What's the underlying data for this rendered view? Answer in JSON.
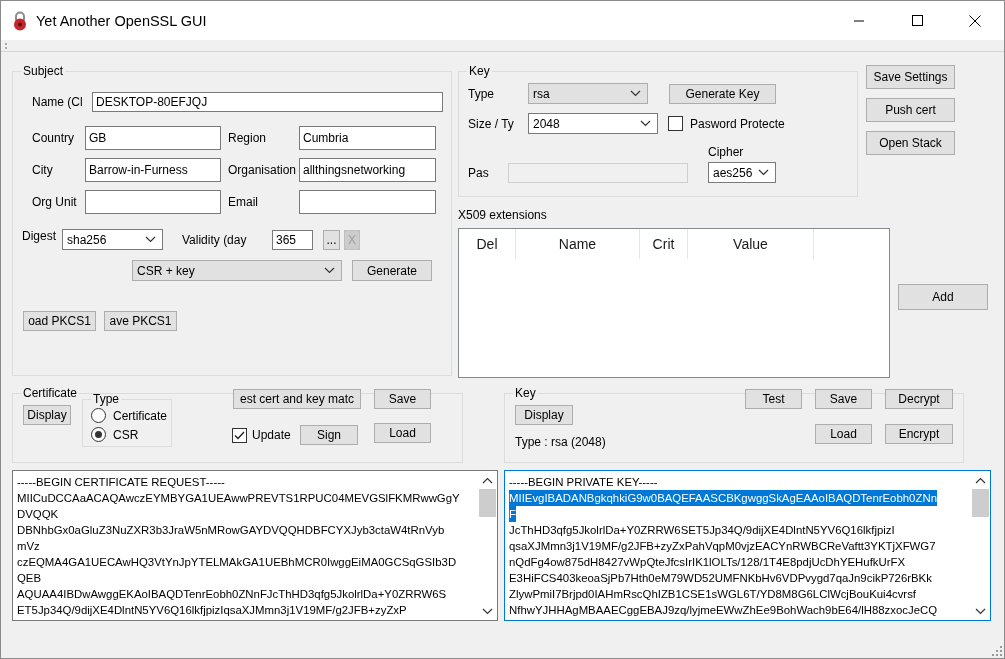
{
  "window": {
    "title": "Yet Another OpenSSL GUI"
  },
  "subject": {
    "title": "Subject",
    "name": {
      "label": "Name (Cl",
      "value": "DESKTOP-80EFJQJ"
    },
    "fields": [
      {
        "label": "Country",
        "value": "GB"
      },
      {
        "label": "Region",
        "value": "Cumbria"
      },
      {
        "label": "City",
        "value": "Barrow-in-Furness"
      },
      {
        "label": "Organisation",
        "value": "allthingsnetworking"
      },
      {
        "label": "Org Unit"
      },
      {
        "label": "Email"
      }
    ],
    "digest": {
      "label": "Digest",
      "value": "sha256"
    },
    "validity": {
      "label": "Validity (day",
      "value": "365"
    },
    "browse_button": {
      "label": "...",
      "disabled": false
    },
    "clear_button": {
      "label": "X",
      "disabled": true
    },
    "output": {
      "value": "CSR + key"
    },
    "generate_button": "Generate",
    "pkcs_buttons": [
      "oad PKCS1",
      "ave PKCS1"
    ]
  },
  "key": {
    "title": "Key",
    "type": {
      "label": "Type",
      "value": "rsa"
    },
    "generate_button": "Generate Key",
    "size": {
      "label": "Size / Ty",
      "value": "2048"
    },
    "password_protected": {
      "label": "Pasword Protecte",
      "checked": false
    },
    "password": {
      "label": "Pas",
      "disabled": true
    },
    "cipher": {
      "label": "Cipher",
      "value": "aes256"
    }
  },
  "side_buttons": [
    "Save Settings",
    "Push cert",
    "Open Stack"
  ],
  "extensions": {
    "label": "X509 extensions",
    "columns": [
      "Del",
      "Name",
      "Crit",
      "Value"
    ],
    "add_button": "Add"
  },
  "certificate": {
    "title": "Certificate",
    "display_button": "Display",
    "type_group": {
      "title": "Type",
      "options": [
        {
          "label": "Certificate",
          "selected": false
        },
        {
          "label": "CSR",
          "selected": true
        }
      ]
    },
    "test_button": "est cert and key matc",
    "save_button": "Save",
    "update": {
      "label": "Update",
      "checked": true
    },
    "sign_button": "Sign",
    "load_button": "Load"
  },
  "key_panel": {
    "title": "Key",
    "display_button": "Display",
    "type_info": "Type : rsa (2048)",
    "buttons": [
      "Test",
      "Save",
      "Decrypt",
      "Load",
      "Encrypt"
    ]
  },
  "certificate_text": {
    "lines": [
      {
        "text": "-----BEGIN CERTIFICATE REQUEST-----",
        "selected": false
      },
      {
        "text": "MIICuDCCAaACAQAwczEYMBYGA1UEAwwPREVTS1RPUC04MEVGSlFKMRwwGgY",
        "selected": false
      },
      {
        "text": "DVQQK",
        "selected": false
      },
      {
        "text": "DBNhbGx0aGluZ3NuZXR3b3JraW5nMRowGAYDVQQHDBFCYXJyb3ctaW4tRnVyb",
        "selected": false
      },
      {
        "text": "mVz",
        "selected": false
      },
      {
        "text": "czEQMA4GA1UECAwHQ3VtYnJpYTELMAkGA1UEBhMCR0IwggEiMA0GCSqGSIb3D",
        "selected": false
      },
      {
        "text": "QEB",
        "selected": false
      },
      {
        "text": "AQUAA4IBDwAwggEKAoIBAQDTenrEobh0ZNnFJcThHD3qfg5JkolrlDa+Y0ZRRW6S",
        "selected": false
      },
      {
        "text": "ET5Jp34Q/9dijXE4DlntN5YV6Q16lkfjpizIqsaXJMmn3j1V19MF/g2JFB+zyZxP",
        "selected": false
      }
    ]
  },
  "key_text": {
    "focused": true,
    "lines": [
      {
        "text": "-----BEGIN PRIVATE KEY-----",
        "selected": false
      },
      {
        "text": "MIIEvgIBADANBgkqhkiG9w0BAQEFAASCBKgwggSkAgEAAoIBAQDTenrEobh0ZNn",
        "selected": true
      },
      {
        "text": "F",
        "selected": true
      },
      {
        "text": "JcThHD3qfg5JkolrlDa+Y0ZRRW6SET5Jp34Q/9dijXE4DlntN5YV6Q16lkfjpizI",
        "selected": false
      },
      {
        "text": "qsaXJMmn3j1V19MF/g2JFB+zyZxPahVqpM0vjzEACYnRWBCReVaftt3YKTjXFWG7",
        "selected": false
      },
      {
        "text": "nQdFg4ow875dH8427vWpQteJfcsIrIK1lOLTs/128/1T4E8pdjUcDhYEHufkUrFX",
        "selected": false
      },
      {
        "text": "E3HiFCS403keoaSjPb7Hth0eM79WD52UMFNKbHv6VDPvygd7qaJn9cikP726rBKk",
        "selected": false
      },
      {
        "text": "ZlywPmiI7Brjpd0IAHmRscQhIZB1CSE1sWGL6T/YD8M8G6LClWcjBouKui4cvrsf",
        "selected": false
      },
      {
        "text": "NfhwYJHHAgMBAAECggEBAJ9zq/lyjmeEWwZhEe9BohWach9bE64/lH88zxocJeCQ",
        "selected": false
      }
    ]
  }
}
